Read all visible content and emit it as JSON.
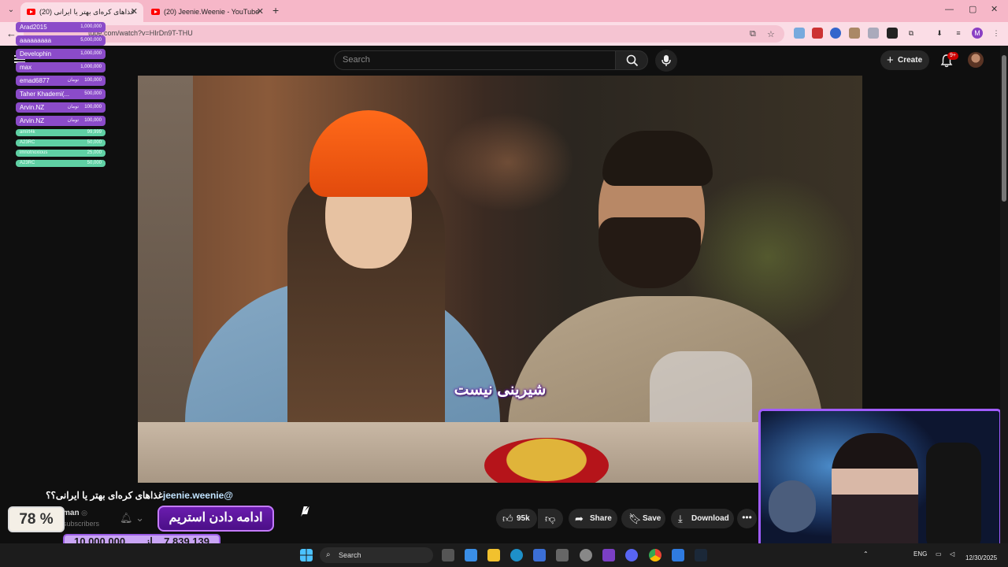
{
  "browser": {
    "tabs": [
      {
        "label": "(20) غذاهای کره‌ای بهتر یا ایرانی",
        "active": true
      },
      {
        "label": "(20) Jeenie.Weenie - YouTube",
        "active": false
      }
    ],
    "url": "tube.com/watch?v=HIrDn9T-THU"
  },
  "youtube": {
    "search_placeholder": "Search",
    "create_label": "Create",
    "notification_count": "9+",
    "video": {
      "subtitle": "شیرینی نیست",
      "title_handle": "@jeenie.weenie",
      "title_text": "غذاهای کره‌ای بهتر یا ایرانی؟؟",
      "channel_fragment": "man",
      "subscribers_fragment": "subscribers"
    },
    "actions": {
      "like_count": "95k",
      "share_label": "Share",
      "save_label": "Save",
      "download_label": "Download"
    }
  },
  "donations": [
    {
      "name": "Arad2015",
      "amount": "1,000,000",
      "currency": "",
      "color": "purple"
    },
    {
      "name": "aaaaaaaaa",
      "amount": "5,000,000",
      "currency": "",
      "color": "purple"
    },
    {
      "name": "Develophin",
      "amount": "1,000,000",
      "currency": "",
      "color": "purple"
    },
    {
      "name": "max",
      "amount": "1,000,000",
      "currency": "",
      "color": "purple"
    },
    {
      "name": "emad6877",
      "amount": "100,000",
      "currency": "تومان",
      "color": "purple"
    },
    {
      "name": "Taher Khademi(...",
      "amount": "500,000",
      "currency": "",
      "color": "purple"
    },
    {
      "name": "Arvin.NZ",
      "amount": "100,000",
      "currency": "تومان",
      "color": "purple"
    },
    {
      "name": "Arvin.NZ",
      "amount": "100,000",
      "currency": "تومان",
      "color": "purple"
    },
    {
      "name": "amirt4k",
      "amount": "99,999",
      "currency": "",
      "color": "green"
    },
    {
      "name": "A23RC",
      "amount": "50,000",
      "currency": "",
      "color": "green"
    },
    {
      "name": "imnotnoxious",
      "amount": "25,000",
      "currency": "",
      "color": "green"
    },
    {
      "name": "A23RC",
      "amount": "50,000",
      "currency": "",
      "color": "green"
    }
  ],
  "stream": {
    "percent": "78 %",
    "continue_label": "ادامه دادن استریم",
    "goal_total": "10,000,000",
    "goal_of": "از",
    "goal_current": "7,839,139"
  },
  "taskbar": {
    "search_label": "Search",
    "language": "ENG",
    "date": "12/30/2025"
  },
  "colors": {
    "tab_strip": "#f6b7c8",
    "stream_accent": "#a05cff",
    "donation_purple": "#8b4bc9",
    "donation_green": "#5fd0a4"
  }
}
